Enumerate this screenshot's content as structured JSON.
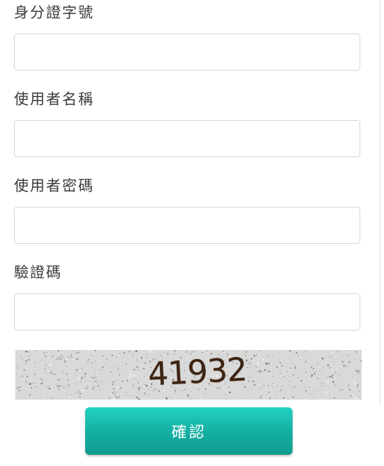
{
  "form": {
    "id_number": {
      "label": "身分證字號",
      "value": "",
      "placeholder": ""
    },
    "username": {
      "label": "使用者名稱",
      "value": "",
      "placeholder": ""
    },
    "password": {
      "label": "使用者密碼",
      "value": "",
      "placeholder": ""
    },
    "captcha": {
      "label": "驗證碼",
      "value": "",
      "placeholder": "",
      "image_text": "41932"
    },
    "confirm_label": "確認"
  },
  "colors": {
    "button_accent": "#15b3a5",
    "label_text": "#3a3a3a",
    "input_border": "#d5d5d5"
  }
}
